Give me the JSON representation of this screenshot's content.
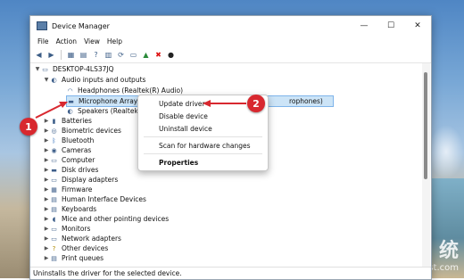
{
  "window": {
    "title": "Device Manager"
  },
  "menu": [
    "File",
    "Action",
    "View",
    "Help"
  ],
  "tree": {
    "root": "DESKTOP-4LS37JQ",
    "expanded_group": "Audio inputs and outputs",
    "children": [
      "Headphones (Realtek(R) Audio)",
      "Microphone Array (In",
      "Speakers (Realtek(R) A"
    ],
    "selected_suffix": "rophones)",
    "categories": [
      "Batteries",
      "Biometric devices",
      "Bluetooth",
      "Cameras",
      "Computer",
      "Disk drives",
      "Display adapters",
      "Firmware",
      "Human Interface Devices",
      "Keyboards",
      "Mice and other pointing devices",
      "Monitors",
      "Network adapters",
      "Other devices",
      "Print queues"
    ]
  },
  "context_menu": {
    "items": [
      "Update driver",
      "Disable device",
      "Uninstall device",
      "Scan for hardware changes",
      "Properties"
    ]
  },
  "annotations": [
    "1",
    "2"
  ],
  "status": "Uninstalls the driver for the selected device.",
  "watermark": {
    "text1": "统",
    "text2": "Daigihost.com"
  }
}
